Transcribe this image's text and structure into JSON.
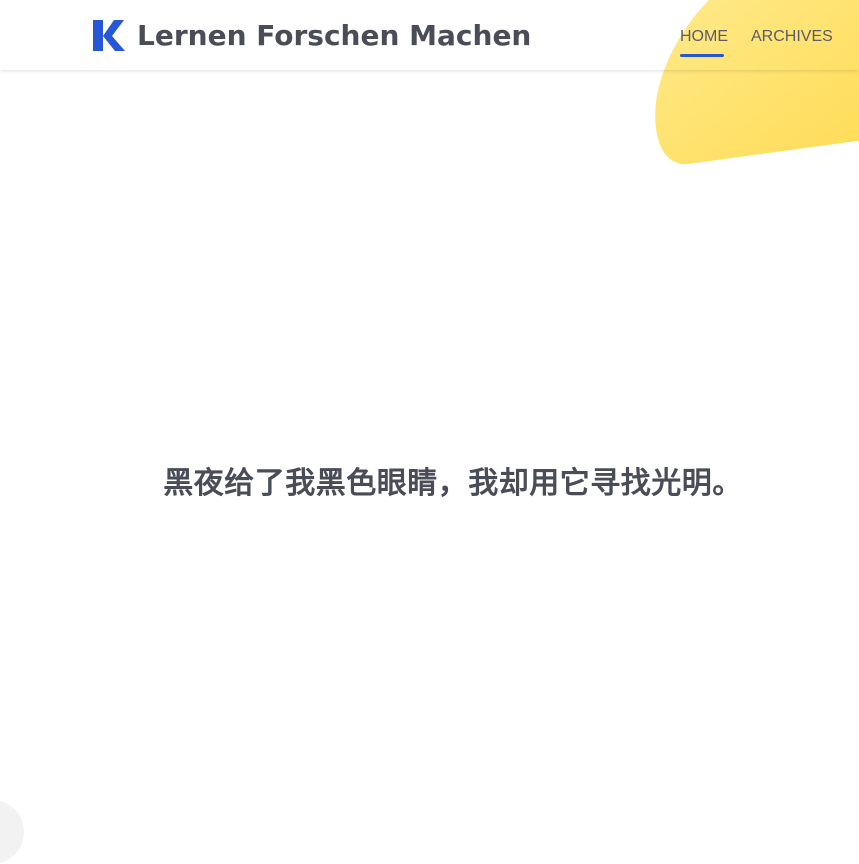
{
  "header": {
    "site_title": "Lernen Forschen Machen",
    "logo_icon": "k-logo-icon",
    "nav": [
      {
        "label": "HOME",
        "active": true
      },
      {
        "label": "ARCHIVES",
        "active": false
      }
    ]
  },
  "hero": {
    "quote": "黑夜给了我黑色眼睛，我却用它寻找光明。"
  },
  "colors": {
    "brand_blue": "#2557d6",
    "accent_yellow": "#ffdf5e",
    "text": "#4a4d57"
  }
}
